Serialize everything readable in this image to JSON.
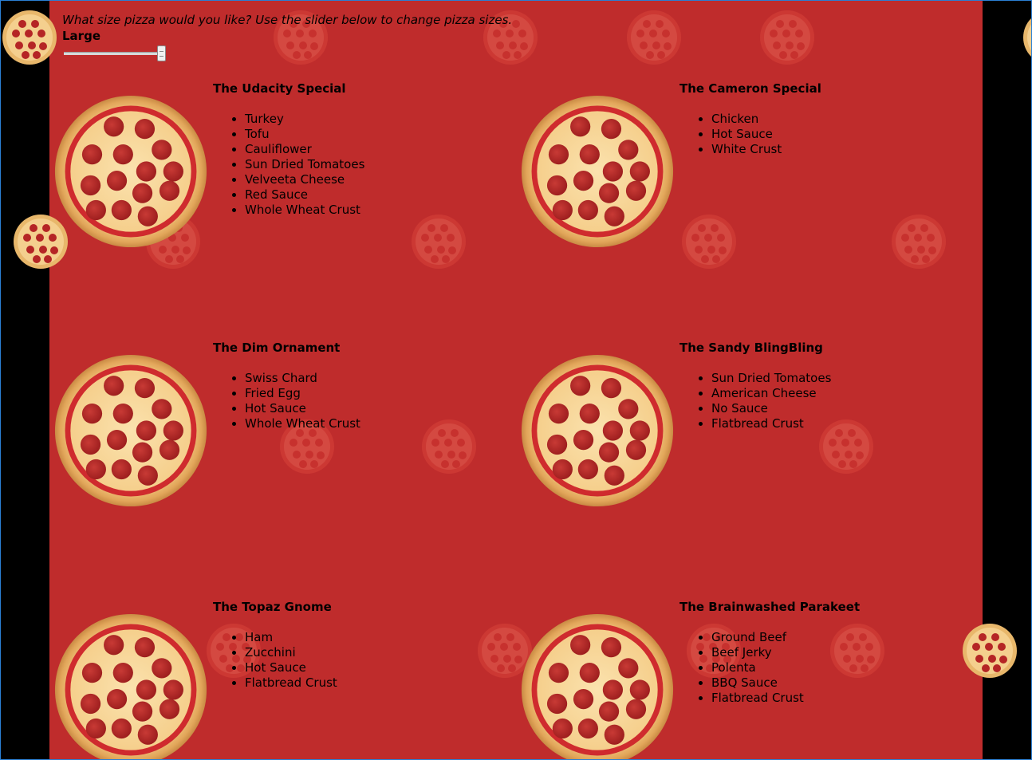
{
  "header": {
    "prompt": "What size pizza would you like? Use the slider below to change pizza sizes.",
    "size_label": "Large"
  },
  "slider": {
    "value_fraction": 1.0
  },
  "colors": {
    "page_background": "#bf2c2c",
    "sidebar_background": "#000000",
    "crust": "#e8b76b",
    "sauce": "#cc2a2a",
    "cheese": "#f7d79a",
    "pepperoni": "#b52525"
  },
  "pizzas": [
    {
      "name": "The Udacity Special",
      "ingredients": [
        "Turkey",
        "Tofu",
        "Cauliflower",
        "Sun Dried Tomatoes",
        "Velveeta Cheese",
        "Red Sauce",
        "Whole Wheat Crust"
      ]
    },
    {
      "name": "The Cameron Special",
      "ingredients": [
        "Chicken",
        "Hot Sauce",
        "White Crust"
      ]
    },
    {
      "name": "The Dim Ornament",
      "ingredients": [
        "Swiss Chard",
        "Fried Egg",
        "Hot Sauce",
        "Whole Wheat Crust"
      ]
    },
    {
      "name": "The Sandy BlingBling",
      "ingredients": [
        "Sun Dried Tomatoes",
        "American Cheese",
        "No Sauce",
        "Flatbread Crust"
      ]
    },
    {
      "name": "The Topaz Gnome",
      "ingredients": [
        "Ham",
        "Zucchini",
        "Hot Sauce",
        "Flatbread Crust"
      ]
    },
    {
      "name": "The Brainwashed Parakeet",
      "ingredients": [
        "Ground Beef",
        "Beef Jerky",
        "Polenta",
        "BBQ Sauce",
        "Flatbread Crust"
      ]
    }
  ]
}
